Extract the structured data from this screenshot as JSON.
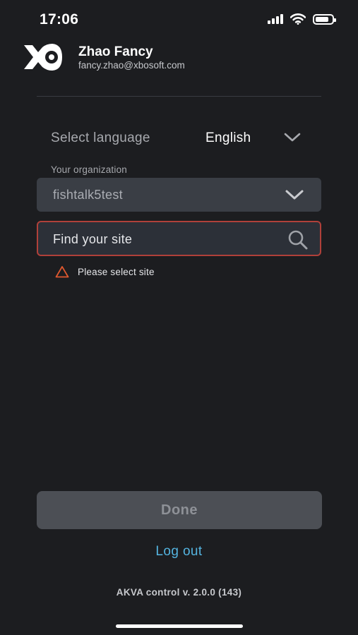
{
  "status_bar": {
    "time": "17:06",
    "icons": [
      "cellular-signal-icon",
      "wifi-icon",
      "battery-icon"
    ]
  },
  "profile": {
    "name": "Zhao Fancy",
    "email": "fancy.zhao@xbosoft.com",
    "logo_icon": "akva-fish-logo-icon"
  },
  "language": {
    "label": "Select language",
    "value": "English",
    "icon": "chevron-down-icon"
  },
  "organization": {
    "label": "Your organization",
    "value": "fishtalk5test",
    "icon": "chevron-down-icon"
  },
  "site_search": {
    "placeholder": "Find your site",
    "value": "",
    "icon": "search-icon",
    "error_text": "Please select site",
    "error_icon": "warning-triangle-icon"
  },
  "actions": {
    "done_label": "Done",
    "logout_label": "Log out"
  },
  "footer": {
    "version": "AKVA control v. 2.0.0 (143)"
  },
  "colors": {
    "background": "#1c1d20",
    "field_background": "#3a3e45",
    "error_border": "#b0403a",
    "warning": "#e0582f",
    "link": "#54b4e0",
    "disabled_button": "#4c4f55"
  }
}
